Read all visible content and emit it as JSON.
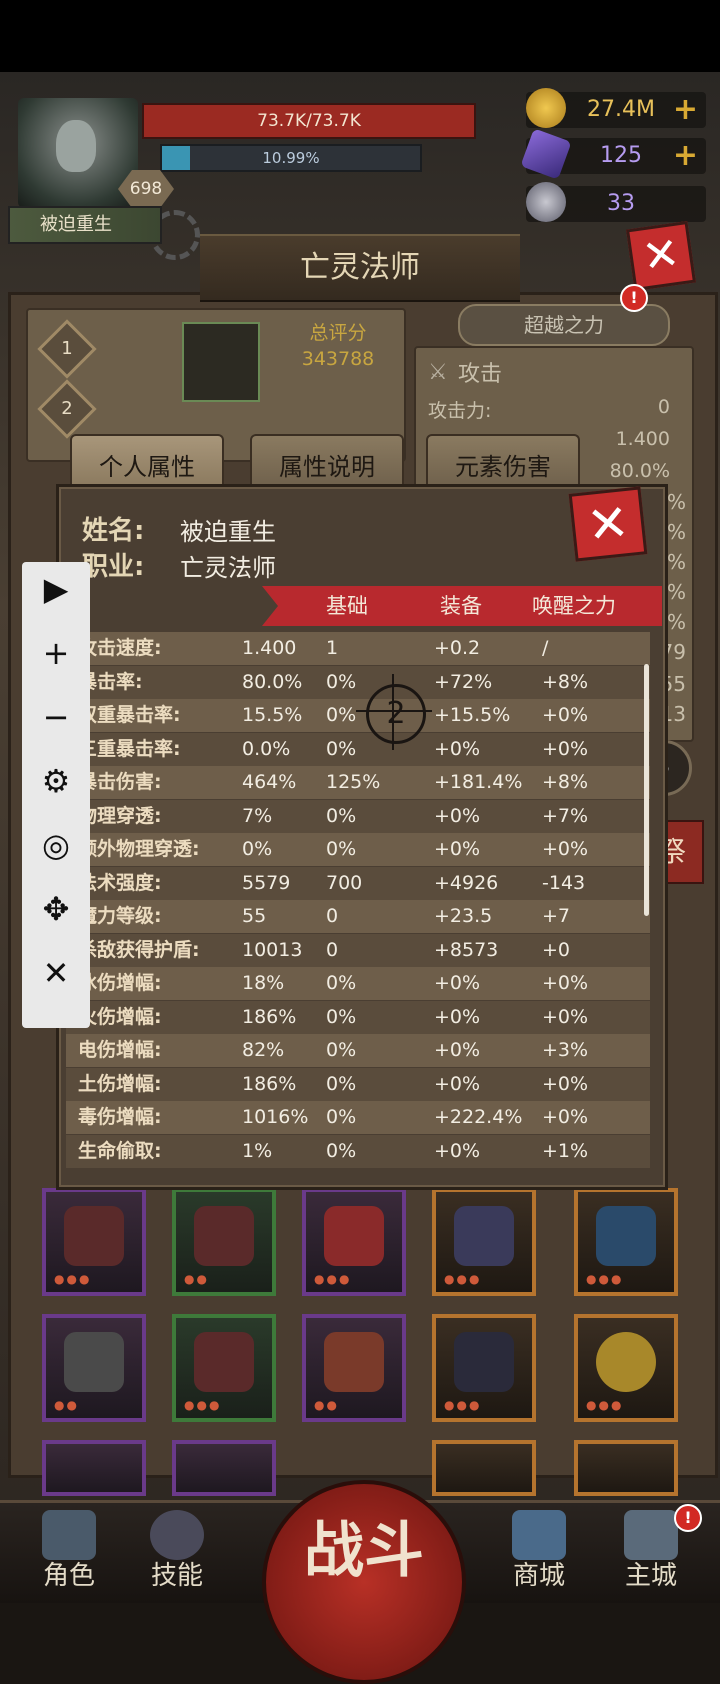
{
  "hud": {
    "hp_text": "73.7K/73.7K",
    "xp_text": "10.99%",
    "xp_fraction": 0.11,
    "level": "698",
    "player_name": "被迫重生",
    "gold": "27.4M",
    "gems": "125",
    "tokens": "33"
  },
  "background": {
    "title": "亡灵法师",
    "slot1": "1",
    "slot2": "2",
    "score_label": "总评分",
    "score_value": "343788",
    "transcend_label": "超越之力",
    "badge": "!",
    "attack_title": "攻击",
    "attack_rows": [
      {
        "label": "攻击力:",
        "value": "0"
      },
      {
        "label": "",
        "value": "1.400"
      },
      {
        "label": "",
        "value": "80.0%"
      }
    ],
    "peek_values": [
      "%",
      "%",
      "%",
      "%",
      "%",
      "79",
      "55",
      "13"
    ],
    "ji_label": "祭"
  },
  "tabs": [
    "个人属性",
    "属性说明",
    "元素伤害"
  ],
  "dialog": {
    "name_label": "姓名:",
    "name_value": "被迫重生",
    "class_label": "职业:",
    "class_value": "亡灵法师",
    "columns": [
      "基础",
      "装备",
      "唤醒之力"
    ],
    "crosshair_number": "2",
    "rows": [
      [
        "攻击速度:",
        "1.400",
        "1",
        "+0.2",
        "/"
      ],
      [
        "暴击率:",
        "80.0%",
        "0%",
        "+72%",
        "+8%"
      ],
      [
        "双重暴击率:",
        "15.5%",
        "0%",
        "+15.5%",
        "+0%"
      ],
      [
        "三重暴击率:",
        "0.0%",
        "0%",
        "+0%",
        "+0%"
      ],
      [
        "暴击伤害:",
        "464%",
        "125%",
        "+181.4%",
        "+8%"
      ],
      [
        "物理穿透:",
        "7%",
        "0%",
        "+0%",
        "+7%"
      ],
      [
        "额外物理穿透:",
        "0%",
        "0%",
        "+0%",
        "+0%"
      ],
      [
        "法术强度:",
        "5579",
        "700",
        "+4926",
        "-143"
      ],
      [
        "魔力等级:",
        "55",
        "0",
        "+23.5",
        "+7"
      ],
      [
        "杀敌获得护盾:",
        "10013",
        "0",
        "+8573",
        "+0"
      ],
      [
        "冰伤增幅:",
        "18%",
        "0%",
        "+0%",
        "+0%"
      ],
      [
        "火伤增幅:",
        "186%",
        "0%",
        "+0%",
        "+0%"
      ],
      [
        "电伤增幅:",
        "82%",
        "0%",
        "+0%",
        "+3%"
      ],
      [
        "土伤增幅:",
        "186%",
        "0%",
        "+0%",
        "+0%"
      ],
      [
        "毒伤增幅:",
        "1016%",
        "0%",
        "+222.4%",
        "+0%"
      ],
      [
        "生命偷取:",
        "1%",
        "0%",
        "+0%",
        "+1%"
      ]
    ]
  },
  "toolbar": {
    "play": "▶",
    "plus": "+",
    "minus": "−",
    "settings": "⚙",
    "hide": "◎",
    "move": "✥",
    "close": "✕"
  },
  "nav": {
    "role": "角色",
    "skill": "技能",
    "battle": "战斗",
    "shop": "商城",
    "city": "主城",
    "city_badge": "!"
  },
  "colors": {
    "accent_red": "#b8292e",
    "gold": "#d8a933",
    "hp": "#9b2a22",
    "xp": "#3a95b3"
  }
}
